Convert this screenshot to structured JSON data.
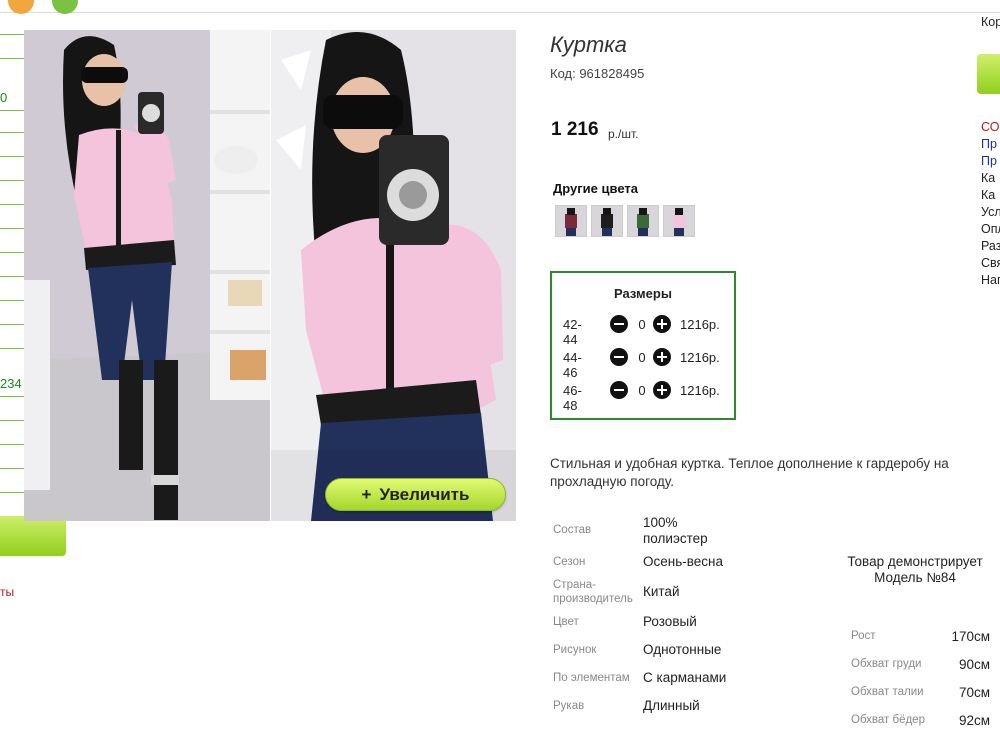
{
  "product": {
    "title": "Куртка",
    "code": "Код: 961828495",
    "price": "1 216",
    "price_unit": "р./шт.",
    "other_colors_label": "Другие цвета",
    "zoom_button": "Увеличить",
    "zoom_plus": "+"
  },
  "sizes": {
    "title": "Размеры",
    "rows": [
      {
        "size": "42-44",
        "qty": "0",
        "price": "1216р."
      },
      {
        "size": "44-46",
        "qty": "0",
        "price": "1216р."
      },
      {
        "size": "46-48",
        "qty": "0",
        "price": "1216р."
      }
    ]
  },
  "description": "Стильная и удобная куртка. Теплое дополнение к гардеробу на прохладную погоду.",
  "attributes": [
    {
      "label": "Состав",
      "value": "100% полиэстер"
    },
    {
      "label": "Сезон",
      "value": "Осень-весна"
    },
    {
      "label": "Страна-производитель",
      "value": "Китай"
    },
    {
      "label": "Цвет",
      "value": "Розовый"
    },
    {
      "label": "Рисунок",
      "value": "Однотонные"
    },
    {
      "label": "По элементам",
      "value": "С карманами"
    },
    {
      "label": "Рукав",
      "value": "Длинный"
    }
  ],
  "model": {
    "caption": "Товар демонстрирует Модель №84",
    "measurements": [
      {
        "label": "Рост",
        "value": "170см"
      },
      {
        "label": "Обхват груди",
        "value": "90см"
      },
      {
        "label": "Обхват талии",
        "value": "70см"
      },
      {
        "label": "Обхват бёдер",
        "value": "92см"
      }
    ]
  },
  "left_sidebar": {
    "num1": "0",
    "num2": "234",
    "red_text": "ты"
  },
  "right_sidebar": {
    "top": "Кор",
    "items": [
      "СО",
      "Пр",
      "Пр",
      "Ка",
      "Ка",
      "Усл",
      "Опл",
      "Раз",
      "Свя",
      "Наг"
    ]
  },
  "colors": {
    "accent_green": "#2c8a2c",
    "button_lime": "#a4d62a",
    "jacket_pink": "#f4c3dc"
  }
}
